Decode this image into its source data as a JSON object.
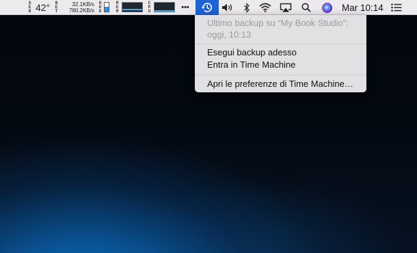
{
  "menubar": {
    "weather_label": "SEN",
    "temperature": "42°",
    "net_label": "NET",
    "net_upload": "32.1KB/s",
    "net_download": "780.2KB/s",
    "hdd_label": "HDD",
    "mem_label": "MEM",
    "cpu_label": "CPU",
    "more_label": "•••",
    "clock": "Mar 10:14",
    "icons": [
      "time-machine-icon",
      "volume-icon",
      "bluetooth-icon",
      "wifi-icon",
      "airplay-icon",
      "search-icon",
      "siri-icon",
      "list-icon"
    ]
  },
  "menu": {
    "last_backup_line1": "Ultimo backup su “My Book Studio”:",
    "last_backup_line2": "oggi, 10:13",
    "backup_now": "Esegui backup adesso",
    "enter_tm": "Entra in Time Machine",
    "open_prefs": "Apri le preferenze di Time Machine…"
  },
  "colors": {
    "menubar_bg": "#eceaec",
    "active_blue": "#1d64d6",
    "graph_line": "#4da7e8"
  }
}
